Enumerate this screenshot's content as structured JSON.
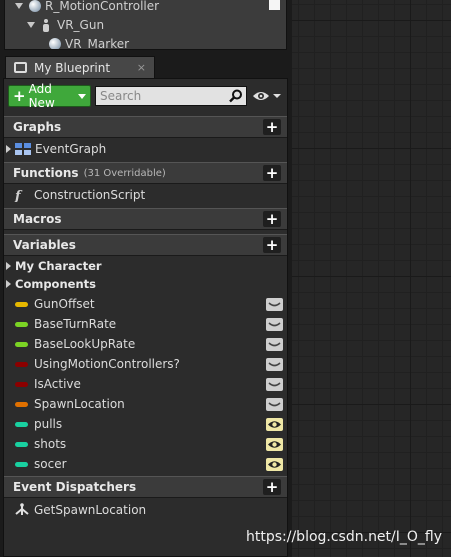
{
  "component_tree": {
    "items": [
      {
        "label": "R_MotionController"
      },
      {
        "label": "VR_Gun"
      },
      {
        "label": "VR_Marker"
      }
    ]
  },
  "tab": {
    "label": "My Blueprint",
    "close": "×"
  },
  "toolbar": {
    "add_new_label": "Add New",
    "search_placeholder": "Search"
  },
  "sections": {
    "graphs": {
      "title": "Graphs",
      "items": [
        "EventGraph"
      ]
    },
    "functions": {
      "title": "Functions",
      "subtitle": "(31 Overridable)",
      "items": [
        "ConstructionScript"
      ]
    },
    "macros": {
      "title": "Macros"
    },
    "variables": {
      "title": "Variables",
      "categories": [
        "My Character",
        "Components"
      ],
      "items": [
        {
          "name": "GunOffset",
          "color": "#e6b800",
          "visibility": "closed"
        },
        {
          "name": "BaseTurnRate",
          "color": "#7bd324",
          "visibility": "closed"
        },
        {
          "name": "BaseLookUpRate",
          "color": "#7bd324",
          "visibility": "closed"
        },
        {
          "name": "UsingMotionControllers?",
          "color": "#8b0000",
          "visibility": "closed"
        },
        {
          "name": "IsActive",
          "color": "#8b0000",
          "visibility": "closed"
        },
        {
          "name": "SpawnLocation",
          "color": "#e07000",
          "visibility": "closed"
        },
        {
          "name": "pulls",
          "color": "#19d0a0",
          "visibility": "open"
        },
        {
          "name": "shots",
          "color": "#19d0a0",
          "visibility": "open"
        },
        {
          "name": "socer",
          "color": "#19d0a0",
          "visibility": "open"
        }
      ]
    },
    "event_dispatchers": {
      "title": "Event Dispatchers",
      "items": [
        "GetSpawnLocation"
      ]
    }
  },
  "watermark": "https://blog.csdn.net/I_O_fly"
}
